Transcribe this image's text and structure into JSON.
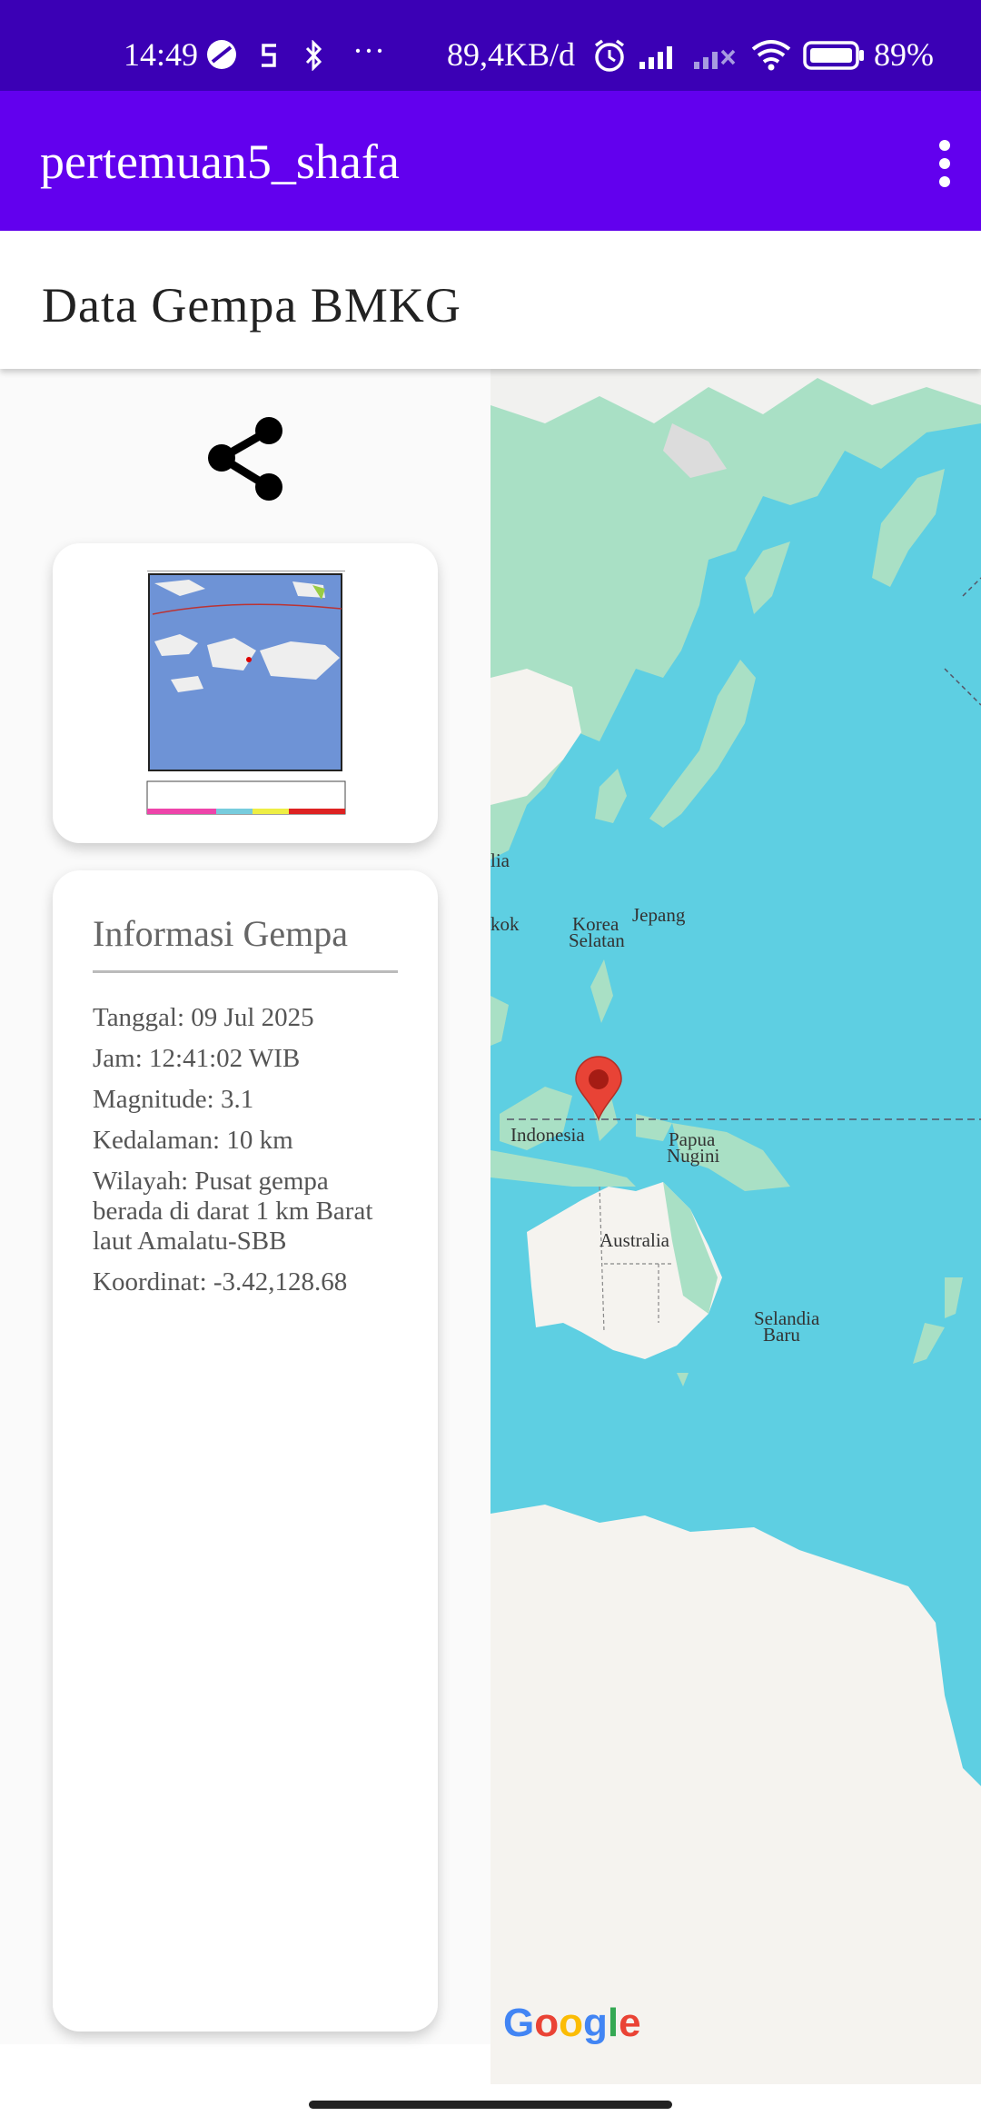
{
  "status_bar": {
    "time": "14:49",
    "more": "···",
    "network_speed": "89,4KB/d",
    "battery": "89%",
    "icons": [
      "clock-icon",
      "s-icon",
      "bluetooth-icon",
      "alarm-icon",
      "signal-icon",
      "signal-off-icon",
      "wifi-icon",
      "battery-icon"
    ]
  },
  "app_bar": {
    "title": "pertemuan5_shafa",
    "menu_icon": "more-vert-icon"
  },
  "header": {
    "title": "Data Gempa BMKG"
  },
  "share_icon": "share-icon",
  "quake_image": {
    "alt": "shakemap"
  },
  "info": {
    "title": "Informasi Gempa",
    "tanggal": "Tanggal: 09 Jul 2025",
    "jam": "Jam: 12:41:02 WIB",
    "magnitude": "Magnitude: 3.1",
    "kedalaman": "Kedalaman: 10 km",
    "wilayah": "Wilayah: Pusat gempa berada di darat 1 km Barat laut Amalatu-SBB",
    "koordinat": "Koordinat: -3.42,128.68"
  },
  "map": {
    "labels": {
      "lia": "lia",
      "kok": "kok",
      "korea_1": "Korea",
      "korea_2": "Selatan",
      "jepang": "Jepang",
      "indonesia": "Indonesia",
      "papua_1": "Papua",
      "papua_2": "Nugini",
      "australia": "Australia",
      "selandia_1": "Selandia",
      "selandia_2": "Baru"
    },
    "logo": "Google",
    "marker_icon": "map-pin-icon",
    "colors": {
      "water": "#5ecfe2",
      "land": "#f5f3ef",
      "green": "#a9e0c5",
      "marker": "#e84336"
    }
  }
}
